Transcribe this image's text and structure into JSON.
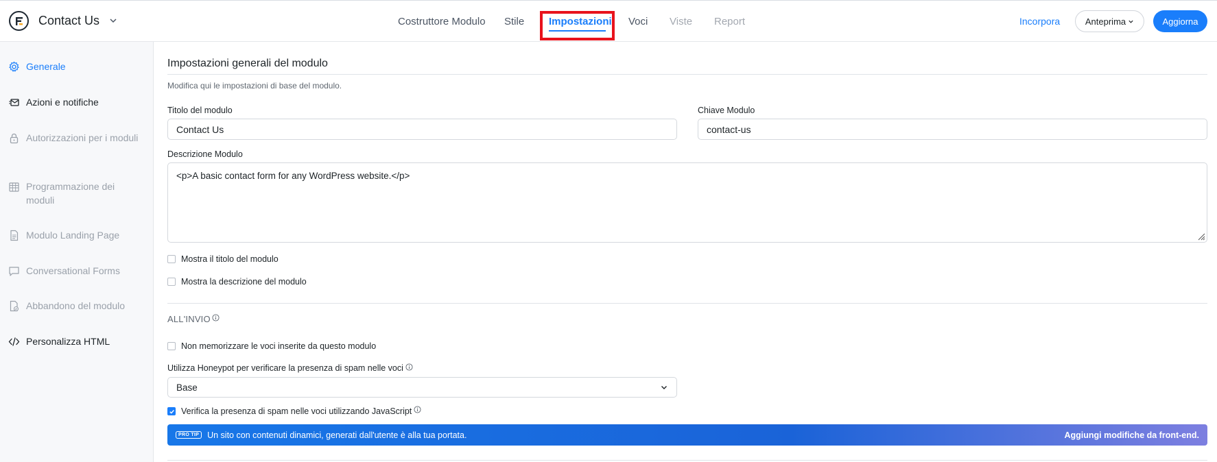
{
  "header": {
    "form_name": "Contact Us",
    "tabs": [
      {
        "label": "Costruttore Modulo",
        "state": "normal"
      },
      {
        "label": "Stile",
        "state": "normal"
      },
      {
        "label": "Impostazioni",
        "state": "active"
      },
      {
        "label": "Voci",
        "state": "normal"
      },
      {
        "label": "Viste",
        "state": "disabled"
      },
      {
        "label": "Report",
        "state": "disabled"
      }
    ],
    "embed_label": "Incorpora",
    "preview_label": "Anteprima",
    "update_label": "Aggiorna"
  },
  "sidebar": {
    "items": [
      {
        "label": "Generale",
        "icon": "gear-icon",
        "state": "active"
      },
      {
        "label": "Azioni e notifiche",
        "icon": "notifications-icon",
        "state": "dark"
      },
      {
        "label": "Autorizzazioni per i moduli",
        "icon": "lock-icon",
        "state": "muted"
      },
      {
        "label": "Programmazione dei moduli",
        "icon": "calendar-icon",
        "state": "muted"
      },
      {
        "label": "Modulo Landing Page",
        "icon": "document-icon",
        "state": "muted"
      },
      {
        "label": "Conversational Forms",
        "icon": "chat-bubble-icon",
        "state": "muted"
      },
      {
        "label": "Abbandono del modulo",
        "icon": "document-check-icon",
        "state": "muted"
      },
      {
        "label": "Personalizza HTML",
        "icon": "code-icon",
        "state": "dark"
      }
    ]
  },
  "main": {
    "title": "Impostazioni generali del modulo",
    "subtitle": "Modifica qui le impostazioni di base del modulo.",
    "form_title_label": "Titolo del modulo",
    "form_title_value": "Contact Us",
    "form_key_label": "Chiave Modulo",
    "form_key_value": "contact-us",
    "description_label": "Descrizione Modulo",
    "description_value": "<p>A basic contact form for any WordPress website.</p>",
    "show_title_label": "Mostra il titolo del modulo",
    "show_title_checked": false,
    "show_description_label": "Mostra la descrizione del modulo",
    "show_description_checked": false,
    "on_submit_section": "ALL'INVIO",
    "no_store_label": "Non memorizzare le voci inserite da questo modulo",
    "no_store_checked": false,
    "honeypot_label": "Utilizza Honeypot per verificare la presenza di spam nelle voci",
    "honeypot_value": "Base",
    "js_spam_label": "Verifica la presenza di spam nelle voci utilizzando JavaScript",
    "js_spam_checked": true,
    "protip_badge": "PRO TIP",
    "protip_text": "Un sito con contenuti dinamici, generati dall'utente è alla tua portata.",
    "protip_cta": "Aggiungi modifiche da front-end."
  }
}
